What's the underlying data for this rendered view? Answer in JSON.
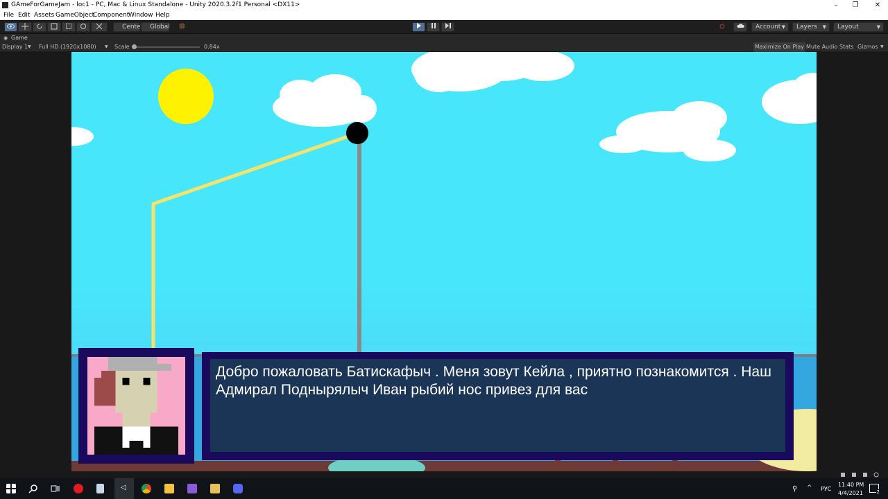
{
  "window": {
    "title": "GAmeForGameJam - loc1 - PC, Mac & Linux Standalone - Unity 2020.3.2f1 Personal <DX11>",
    "controls": [
      "–",
      "❐",
      "✕"
    ]
  },
  "menu": [
    "File",
    "Edit",
    "Assets",
    "GameObject",
    "Component",
    "Window",
    "Help"
  ],
  "toolbar": {
    "pivot_label": "Center",
    "space_label": "Global",
    "account_label": "Account",
    "layers_label": "Layers",
    "layout_label": "Layout"
  },
  "game_view": {
    "tab_label": "Game",
    "display_label": "Display 1",
    "resolution_label": "Full HD (1920x1080)",
    "scale_label": "Scale",
    "scale_value": "0.84x",
    "maximize_label": "Maximize On Play",
    "mute_label": "Mute Audio",
    "stats_label": "Stats",
    "gizmos_label": "Gizmos"
  },
  "dialog": {
    "text": " Добро пожаловать Батискафыч .  Меня  зовут Кейла , приятно познакомится . Наш Адмирал Поднырялыч Иван рыбий нос привез для вас"
  },
  "taskbar": {
    "language": "РУС",
    "time": "11:40 PM",
    "date": "4/4/2021",
    "notification_count": "2"
  },
  "colors": {
    "sky": "#47e6fb",
    "sun": "#fff200",
    "rope": "#f5e36b",
    "dialog_frame": "#1a0a5e",
    "dialog_fill": "#1b3557",
    "portrait_bg": "#f9a9c8"
  }
}
